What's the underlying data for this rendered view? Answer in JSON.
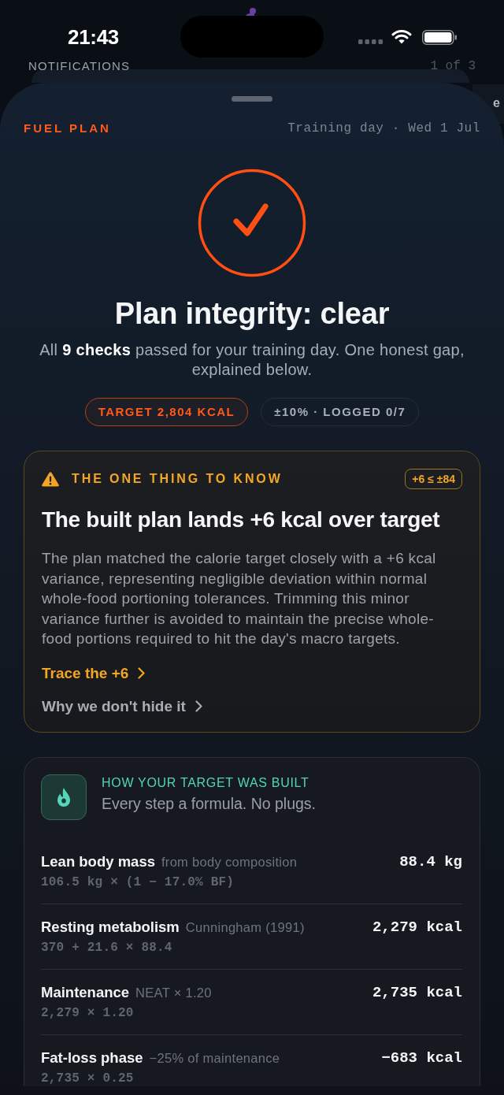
{
  "status_bar": {
    "time": "21:43"
  },
  "notification_header": {
    "label": "NOTIFICATIONS",
    "counter": "1 of 3"
  },
  "adjacent_card": {
    "text_fragment": "e"
  },
  "sheet_header": {
    "eyebrow": "FUEL PLAN",
    "context": "Training day · Wed 1 Jul"
  },
  "verdict": {
    "title": "Plan integrity: clear",
    "summary": "All **9 checks** passed for your training day. One honest gap, explained below.",
    "chips": [
      {
        "label": "TARGET 2,804 KCAL",
        "kind": "accent"
      },
      {
        "label": "±10% · LOGGED 0/7",
        "kind": "muted"
      }
    ]
  },
  "alert_card": {
    "eyebrow": "THE ONE THING TO KNOW",
    "badge": "+6 ≤ ±84",
    "title": "The built plan lands +6 kcal over target",
    "body": "The plan matched the calorie target closely with a +6 kcal variance, representing negligible deviation within normal whole-food portioning tolerances. Trimming this minor variance further is avoided to maintain the precise whole-food portions required to hit the day's macro targets.",
    "links": [
      {
        "label": "Trace the +6",
        "kind": "primary"
      },
      {
        "label": "Why we don't hide it",
        "kind": "secondary"
      }
    ]
  },
  "build_card": {
    "eyebrow": "HOW YOUR TARGET WAS BUILT",
    "subtitle": "Every step a formula. No plugs.",
    "steps": [
      {
        "label": "Lean body mass",
        "note": "from body composition",
        "value": "88.4 kg",
        "formula": "106.5 kg × (1 − 17.0% BF)"
      },
      {
        "label": "Resting metabolism",
        "note": "Cunningham (1991)",
        "value": "2,279 kcal",
        "formula": "370 + 21.6 × 88.4"
      },
      {
        "label": "Maintenance",
        "note": "NEAT × 1.20",
        "value": "2,735 kcal",
        "formula": "2,279 × 1.20"
      },
      {
        "label": "Fat-loss phase",
        "note": "−25% of maintenance",
        "value": "−683 kcal",
        "formula": "2,735 × 0.25"
      }
    ]
  }
}
